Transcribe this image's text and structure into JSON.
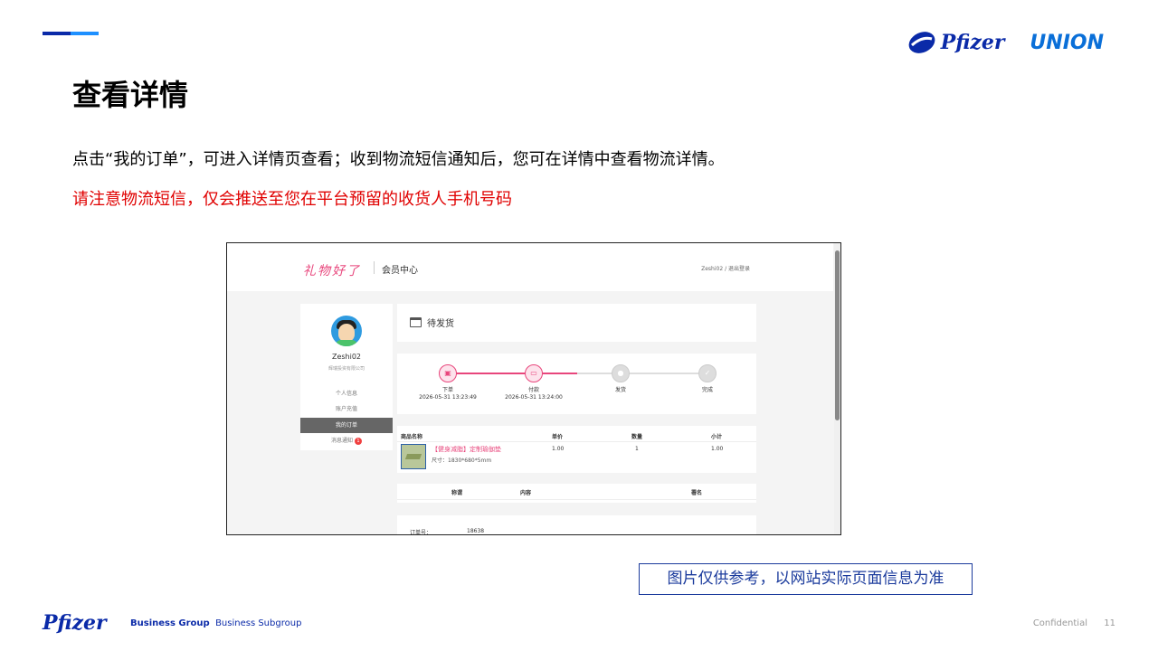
{
  "slide": {
    "title": "查看详情",
    "description": "点击“我的订单”，可进入详情页查看；收到物流短信通知后，您可在详情中查看物流详情。",
    "note": "请注意物流短信，仅会推送至您在平台预留的收货人手机号码",
    "disclaimer": "图片仅供参考，以网站实际页面信息为准",
    "accent_colors": [
      "#0a2aa8",
      "#1e90ff"
    ],
    "note_color": "#e00000"
  },
  "logos": {
    "pfizer": "Pfizer",
    "union": "UNION"
  },
  "screenshot": {
    "brand": "礼物好了",
    "center_title": "会员中心",
    "user_links": "Zeshi02 / 退出登录",
    "sidebar": {
      "username": "Zeshi02",
      "company": "辉瑞投资有限公司",
      "items": [
        {
          "label": "个人信息"
        },
        {
          "label": "账户充值"
        },
        {
          "label": "我的订单"
        },
        {
          "label": "消息通知",
          "badge": "1"
        }
      ]
    },
    "status": "待发货",
    "steps": [
      {
        "label": "下单",
        "time": "2026-05-31 13:23:49",
        "state": "done",
        "icon": "clipboard-icon"
      },
      {
        "label": "付款",
        "time": "2026-05-31 13:24:00",
        "state": "done",
        "icon": "card-icon"
      },
      {
        "label": "发货",
        "time": "",
        "state": "pending",
        "icon": "location-icon"
      },
      {
        "label": "完成",
        "time": "",
        "state": "pending",
        "icon": "check-icon"
      }
    ],
    "order_table": {
      "headers": [
        "商品名称",
        "单价",
        "数量",
        "小计"
      ],
      "row": {
        "name": "【健身减脂】定制瑜伽垫",
        "size": "尺寸：1830*680*5mm",
        "price": "1.00",
        "qty": "1",
        "subtotal": "1.00"
      }
    },
    "message_table": {
      "headers": [
        "称谓",
        "内容",
        "署名"
      ]
    },
    "order_info": {
      "label": "订单号：",
      "value": "18638"
    }
  },
  "footer": {
    "logo": "Pfizer",
    "group": "Business Group",
    "subgroup": "Business Subgroup",
    "confidential": "Confidential",
    "page": "11"
  }
}
